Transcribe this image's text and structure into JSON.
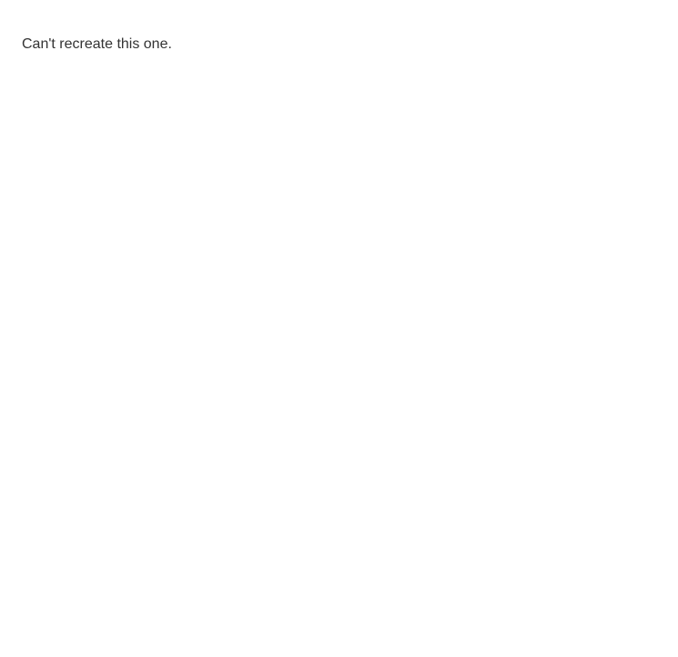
{
  "notice": "Can't recreate this one."
}
